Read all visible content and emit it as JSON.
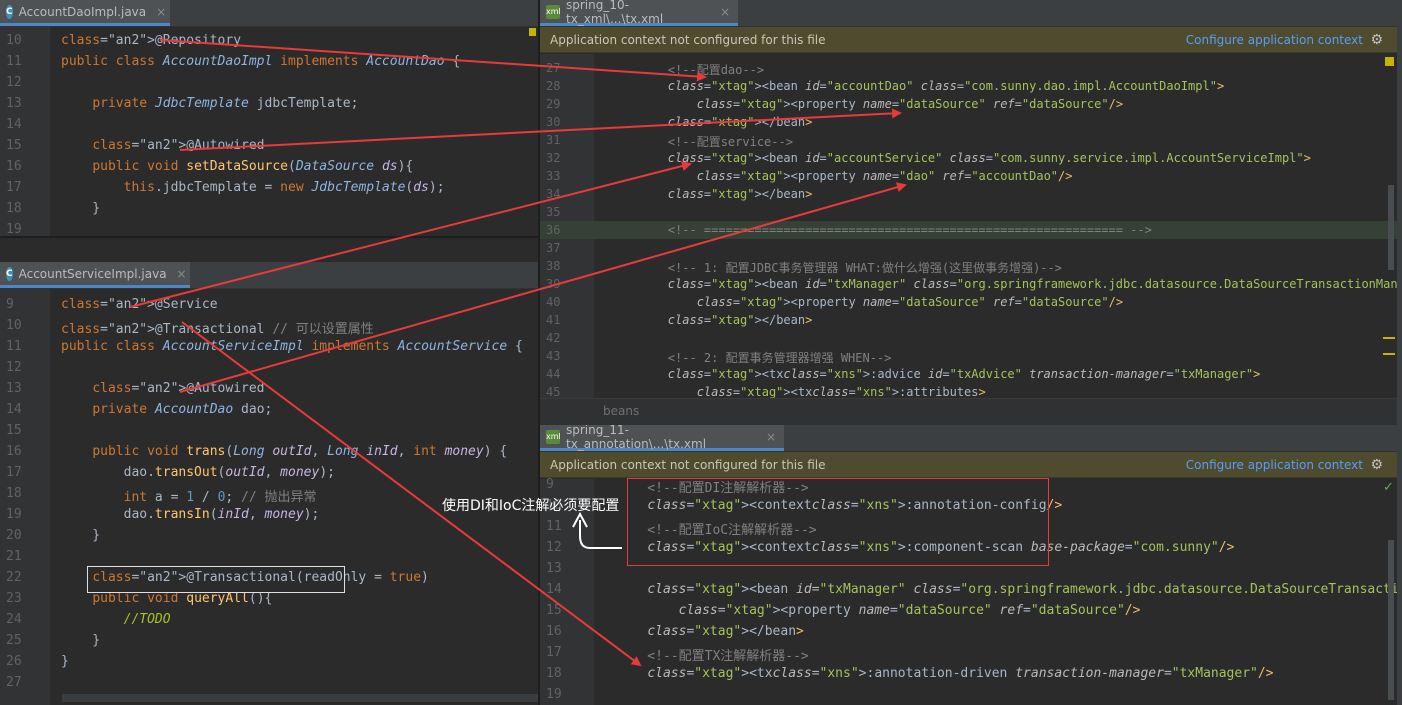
{
  "left_top": {
    "tab": {
      "icon_label": "C",
      "title": "AccountDaoImpl.java",
      "close": "×"
    },
    "lines": [
      {
        "n": "10",
        "text": "@Repository"
      },
      {
        "n": "11",
        "text": "public class AccountDaoImpl implements AccountDao {"
      },
      {
        "n": "12",
        "text": ""
      },
      {
        "n": "13",
        "text": "    private JdbcTemplate jdbcTemplate;"
      },
      {
        "n": "14",
        "text": ""
      },
      {
        "n": "15",
        "text": "    @Autowired"
      },
      {
        "n": "16",
        "text": "    public void setDataSource(DataSource ds){"
      },
      {
        "n": "17",
        "text": "        this.jdbcTemplate = new JdbcTemplate(ds);"
      },
      {
        "n": "18",
        "text": "    }"
      },
      {
        "n": "19",
        "text": ""
      }
    ]
  },
  "left_bottom": {
    "tab": {
      "icon_label": "C",
      "title": "AccountServiceImpl.java",
      "close": "×"
    },
    "lines": [
      {
        "n": "9",
        "text": "@Service"
      },
      {
        "n": "10",
        "text": "@Transactional // 可以设置属性"
      },
      {
        "n": "11",
        "text": "public class AccountServiceImpl implements AccountService {"
      },
      {
        "n": "12",
        "text": ""
      },
      {
        "n": "13",
        "text": "    @Autowired"
      },
      {
        "n": "14",
        "text": "    private AccountDao dao;"
      },
      {
        "n": "15",
        "text": ""
      },
      {
        "n": "16",
        "text": "    public void trans(Long outId, Long inId, int money) {"
      },
      {
        "n": "17",
        "text": "        dao.transOut(outId, money);"
      },
      {
        "n": "18",
        "text": "        int a = 1 / 0; // 抛出异常"
      },
      {
        "n": "19",
        "text": "        dao.transIn(inId, money);"
      },
      {
        "n": "20",
        "text": "    }"
      },
      {
        "n": "21",
        "text": ""
      },
      {
        "n": "22",
        "text": "    @Transactional(readOnly = true)"
      },
      {
        "n": "23",
        "text": "    public void queryAll(){"
      },
      {
        "n": "24",
        "text": "        //TODO"
      },
      {
        "n": "25",
        "text": "    }"
      },
      {
        "n": "26",
        "text": "}"
      },
      {
        "n": "27",
        "text": ""
      }
    ]
  },
  "right_top": {
    "tab": {
      "icon_label": "xml",
      "title": "spring_10-tx_xml\\...\\tx.xml",
      "close": "×"
    },
    "banner": {
      "message": "Application context not configured for this file",
      "link": "Configure application context",
      "gear": "⚙"
    },
    "lines": [
      {
        "n": "27",
        "text": "        <!--配置dao-->"
      },
      {
        "n": "28",
        "text": "        <bean id=\"accountDao\" class=\"com.sunny.dao.impl.AccountDaoImpl\">"
      },
      {
        "n": "29",
        "text": "            <property name=\"dataSource\" ref=\"dataSource\"/>"
      },
      {
        "n": "30",
        "text": "        </bean>"
      },
      {
        "n": "31",
        "text": "        <!--配置service-->"
      },
      {
        "n": "32",
        "text": "        <bean id=\"accountService\" class=\"com.sunny.service.impl.AccountServiceImpl\">"
      },
      {
        "n": "33",
        "text": "            <property name=\"dao\" ref=\"accountDao\"/>"
      },
      {
        "n": "34",
        "text": "        </bean>"
      },
      {
        "n": "35",
        "text": ""
      },
      {
        "n": "36",
        "text": "        <!-- ========================================================== -->"
      },
      {
        "n": "37",
        "text": ""
      },
      {
        "n": "38",
        "text": "        <!-- 1: 配置JDBC事务管理器 WHAT:做什么增强(这里做事务增强)-->"
      },
      {
        "n": "39",
        "text": "        <bean id=\"txManager\" class=\"org.springframework.jdbc.datasource.DataSourceTransactionManager\">"
      },
      {
        "n": "40",
        "text": "            <property name=\"dataSource\" ref=\"dataSource\"/>"
      },
      {
        "n": "41",
        "text": "        </bean>"
      },
      {
        "n": "42",
        "text": ""
      },
      {
        "n": "43",
        "text": "        <!-- 2: 配置事务管理器增强 WHEN-->"
      },
      {
        "n": "44",
        "text": "        <tx:advice id=\"txAdvice\" transaction-manager=\"txManager\">"
      },
      {
        "n": "45",
        "text": "            <tx:attributes>"
      }
    ],
    "breadcrumb": "beans"
  },
  "right_bottom": {
    "tab": {
      "icon_label": "xml",
      "title": "spring_11-tx_annotation\\...\\tx.xml",
      "close": "×"
    },
    "banner": {
      "message": "Application context not configured for this file",
      "link": "Configure application context",
      "gear": "⚙"
    },
    "lines": [
      {
        "n": "9",
        "text": "    <!--配置DI注解解析器-->"
      },
      {
        "n": "10",
        "text": "    <context:annotation-config/>"
      },
      {
        "n": "11",
        "text": "    <!--配置IoC注解解析器-->"
      },
      {
        "n": "12",
        "text": "    <context:component-scan base-package=\"com.sunny\"/>"
      },
      {
        "n": "13",
        "text": ""
      },
      {
        "n": "14",
        "text": "    <bean id=\"txManager\" class=\"org.springframework.jdbc.datasource.DataSourceTransactionManager\">"
      },
      {
        "n": "15",
        "text": "        <property name=\"dataSource\" ref=\"dataSource\"/>"
      },
      {
        "n": "16",
        "text": "    </bean>"
      },
      {
        "n": "17",
        "text": "    <!--配置TX注解解析器-->"
      },
      {
        "n": "18",
        "text": "    <tx:annotation-driven transaction-manager=\"txManager\"/>"
      },
      {
        "n": "19",
        "text": ""
      }
    ]
  },
  "annotation_callout": "使用DI和IoC注解必须要配置",
  "colors": {
    "arrow": "#e83a3a",
    "box_white": "#e0e0e0",
    "box_red": "#e83a3a",
    "link": "#589df6"
  }
}
